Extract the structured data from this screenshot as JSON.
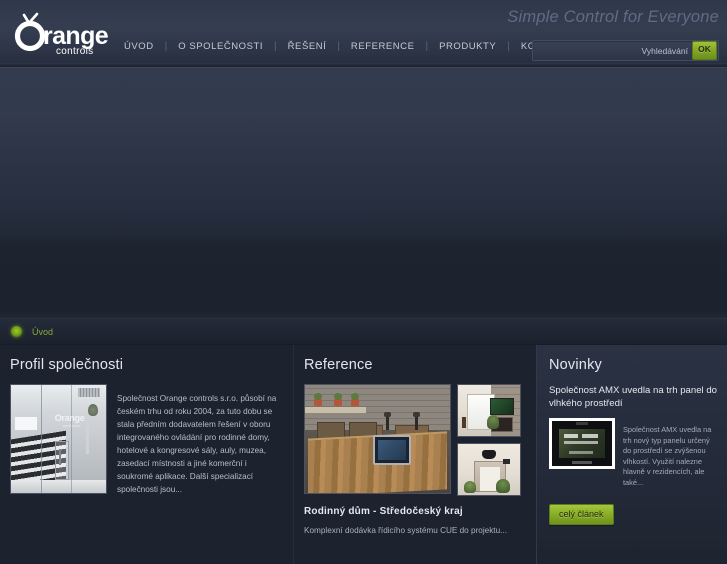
{
  "site": {
    "logo_main": "range",
    "logo_o": "O",
    "logo_sub": "controls",
    "tagline": "Simple Control for Everyone"
  },
  "nav": {
    "items": [
      {
        "label": "ÚVOD"
      },
      {
        "label": "O SPOLEČNOSTI"
      },
      {
        "label": "ŘEŠENÍ"
      },
      {
        "label": "REFERENCE"
      },
      {
        "label": "PRODUKTY"
      },
      {
        "label": "KONTAKTY"
      }
    ],
    "separator": "|"
  },
  "search": {
    "value": "",
    "placeholder": "Vyhledávání",
    "submit_label": "OK"
  },
  "breadcrumb": {
    "items": [
      {
        "label": "Úvod"
      }
    ]
  },
  "profile": {
    "title": "Profil společnosti",
    "image_alt": "lobby-photo",
    "text": "Společnost Orange controls s.r.o. působí na českém trhu od roku 2004, za tuto dobu se stala předním dodavatelem řešení v oboru integrovaného ovládání pro rodinné domy, hotelové a kongresové sály, auly, muzea, zasedací místnosti a jiné komerční i soukromé aplikace. Další specializací společnosti jsou..."
  },
  "reference": {
    "title": "Reference",
    "main_image_alt": "rustic-dining-room-photo",
    "side_image_1_alt": "living-room-fireplace-photo",
    "side_image_2_alt": "hallway-photo",
    "item_title": "Rodinný dům - Středočeský kraj",
    "item_desc": "Komplexní dodávka řídicího systému CUE do projektu..."
  },
  "news": {
    "title": "Novinky",
    "item_title": "Společnost AMX uvedla na trh panel do vlhkého prostředí",
    "thumb_alt": "touch-panel-photo",
    "item_text": "Společnost AMX uvedla na trh nový typ panelu určený do prostředí se zvýšenou vlhkostí. Využití nalezne hlavně v rezidencích, ale také...",
    "button_label": "celý článek"
  },
  "colors": {
    "accent_green": "#88ad27",
    "breadcrumb_green": "#87a93e",
    "header_bg": "#333b4e",
    "page_bg": "#1c222e",
    "panel_bg": "#2b3243"
  }
}
